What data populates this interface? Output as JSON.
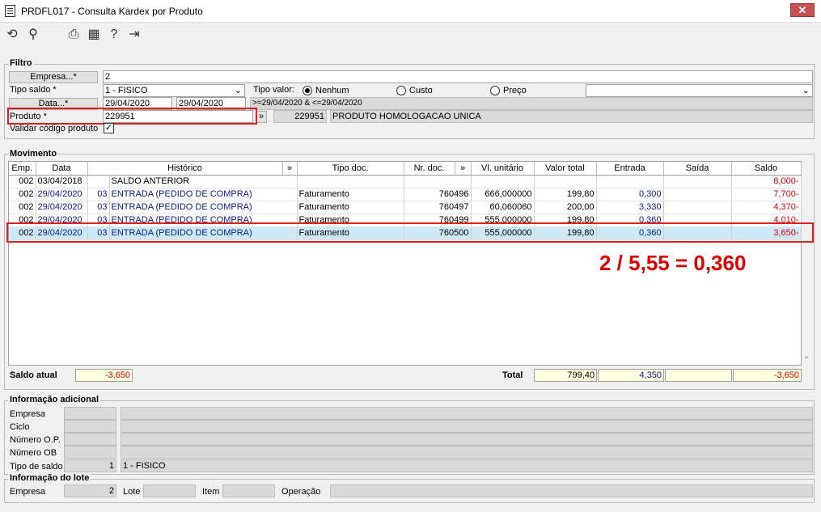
{
  "window": {
    "title": "PRDFL017 - Consulta Kardex por Produto",
    "close": "✕"
  },
  "filtro": {
    "title": "Filtro",
    "empresa_btn": "Empresa...*",
    "empresa_val": "2",
    "tipo_saldo_lbl": "Tipo saldo *",
    "tipo_saldo_val": "1 - FISICO",
    "tipo_valor_lbl": "Tipo valor:",
    "radio_nenhum": "Nenhum",
    "radio_custo": "Custo",
    "radio_preco": "Preço",
    "data_btn": "Data...*",
    "data_ini": "29/04/2020",
    "data_fim": "29/04/2020",
    "data_expr": ">=29/04/2020 & <=29/04/2020",
    "produto_lbl": "Produto *",
    "produto_val": "229951",
    "produto_code": "229951",
    "produto_desc": "PRODUTO HOMOLOGACAO UNICA",
    "validar_lbl": "Validar código produto",
    "chev": "»"
  },
  "mov": {
    "title": "Movimento",
    "headers": [
      "Emp.",
      "Data",
      "Histórico",
      "»",
      "Tipo doc.",
      "Nr. doc.",
      "»",
      "Vl. unitário",
      "Valor total",
      "Entrada",
      "Saída",
      "Saldo"
    ],
    "rows": [
      {
        "emp": "002",
        "data": "03/04/2018",
        "seq": "",
        "hist": "SALDO ANTERIOR",
        "tipo": "",
        "nr": "",
        "vu": "",
        "vt": "",
        "ent": "",
        "sai": "",
        "saldo": "8,000-",
        "cls": ""
      },
      {
        "emp": "002",
        "data": "29/04/2020",
        "seq": "03",
        "hist": "ENTRADA  (PEDIDO DE COMPRA)",
        "tipo": "Faturamento",
        "nr": "760496",
        "vu": "666,000000",
        "vt": "199,80",
        "ent": "0,300",
        "sai": "",
        "saldo": "7,700-",
        "cls": "blue"
      },
      {
        "emp": "002",
        "data": "29/04/2020",
        "seq": "03",
        "hist": "ENTRADA  (PEDIDO DE COMPRA)",
        "tipo": "Faturamento",
        "nr": "760497",
        "vu": "60,060060",
        "vt": "200,00",
        "ent": "3,330",
        "sai": "",
        "saldo": "4,370-",
        "cls": "blue"
      },
      {
        "emp": "002",
        "data": "29/04/2020",
        "seq": "03",
        "hist": "ENTRADA  (PEDIDO DE COMPRA)",
        "tipo": "Faturamento",
        "nr": "760499",
        "vu": "555,000000",
        "vt": "199,80",
        "ent": "0,360",
        "sai": "",
        "saldo": "4,010-",
        "cls": "blue"
      },
      {
        "emp": "002",
        "data": "29/04/2020",
        "seq": "03",
        "hist": "ENTRADA  (PEDIDO DE COMPRA)",
        "tipo": "Faturamento",
        "nr": "760500",
        "vu": "555,000000",
        "vt": "199,80",
        "ent": "0,360",
        "sai": "",
        "saldo": "3,650-",
        "cls": "blue"
      }
    ],
    "saldo_atual_lbl": "Saldo atual",
    "saldo_atual": "-3,650",
    "total_lbl": "Total",
    "total_vt": "799,40",
    "total_ent": "4,350",
    "total_sai": "",
    "total_saldo": "-3,650"
  },
  "annotation": "2 / 5,55 = 0,360",
  "info": {
    "title": "Informação adicional",
    "empresa": "Empresa",
    "ciclo": "Ciclo",
    "numero_op": "Número O.P.",
    "numero_ob": "Número OB",
    "tipo_saldo": "Tipo de saldo",
    "tipo_saldo_code": "1",
    "tipo_saldo_desc": "1 - FISICO"
  },
  "lote": {
    "title": "Informação do lote",
    "empresa": "Empresa",
    "empresa_val": "2",
    "lote": "Lote",
    "item": "Item",
    "operacao": "Operação"
  },
  "colors": {
    "accent_red": "#e00000",
    "row_blue": "#0a1a8c",
    "selected": "#cde8f6"
  }
}
